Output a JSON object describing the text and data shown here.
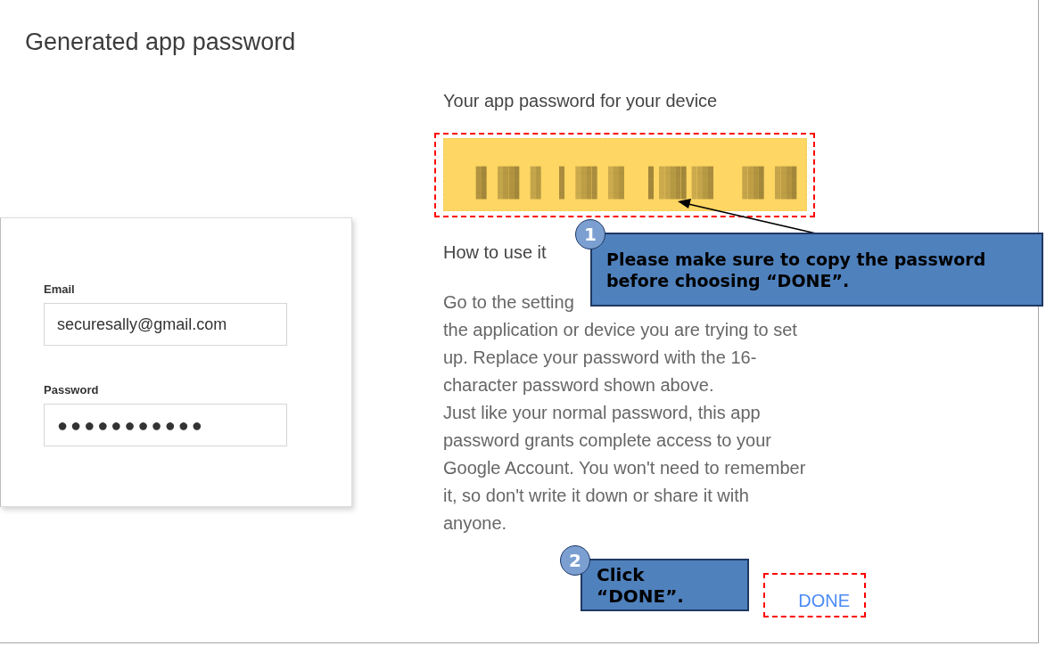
{
  "dialog": {
    "title": "Generated app password"
  },
  "sign_in_card": {
    "fields": [
      {
        "label": "Email",
        "value": "securesally@gmail.com",
        "kind": "text"
      },
      {
        "label": "Password",
        "value": "●●●●●●●●●●●",
        "kind": "password"
      }
    ]
  },
  "password_panel": {
    "heading": "Your app password for your device",
    "how_to_heading": "How to use it",
    "instructions": [
      "Go to the setting",
      "the application or device you are trying to set",
      "up. Replace your password with the 16-",
      "character password shown above.",
      "Just like your normal password, this app",
      "password grants complete access to your",
      "Google Account. You won't need to remember",
      "it, so don't write it down or share it with",
      "anyone."
    ]
  },
  "actions": {
    "done": "DONE"
  },
  "annotations": [
    {
      "number": "1",
      "text": "Please make sure to copy the password\nbefore choosing “DONE”.",
      "kind": "arrow"
    },
    {
      "number": "2",
      "text": "Click “DONE”.",
      "kind": "plain"
    }
  ]
}
